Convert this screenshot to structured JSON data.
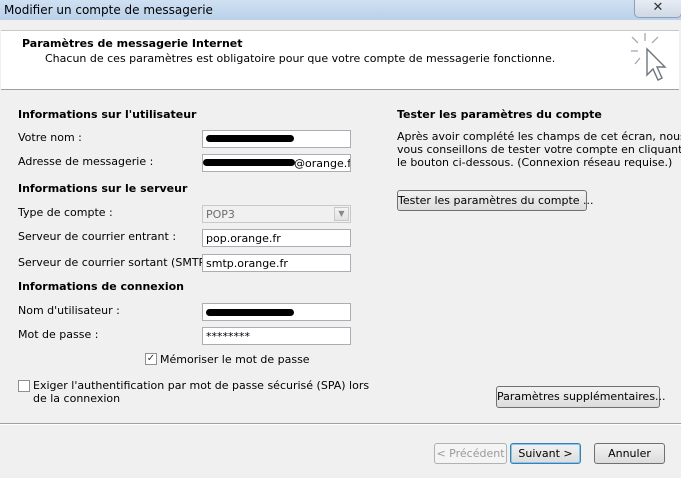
{
  "window": {
    "title": "Modifier un compte de messagerie",
    "close_glyph": "✕"
  },
  "header": {
    "title": "Paramètres de messagerie Internet",
    "description": "Chacun de ces paramètres est obligatoire pour que votre compte de messagerie fonctionne."
  },
  "user_info": {
    "heading": "Informations sur l'utilisateur",
    "name_label": "Votre nom :",
    "email_label": "Adresse de messagerie :",
    "email_suffix": "@orange.fr"
  },
  "server_info": {
    "heading": "Informations sur le serveur",
    "account_type_label": "Type de compte :",
    "account_type_value": "POP3",
    "incoming_label": "Serveur de courrier entrant :",
    "incoming_value": "pop.orange.fr",
    "outgoing_label": "Serveur de courrier sortant (SMTP) :",
    "outgoing_value": "smtp.orange.fr"
  },
  "login_info": {
    "heading": "Informations de connexion",
    "username_label": "Nom d'utilisateur :",
    "password_label": "Mot de passe :",
    "password_value": "********",
    "remember_label": "Mémoriser le mot de passe",
    "remember_checked": true,
    "spa_label_line1": "Exiger l'authentification par mot de passe sécurisé (SPA) lors",
    "spa_label_line2": "de la connexion",
    "spa_checked": false
  },
  "test": {
    "heading": "Tester les paramètres du compte",
    "desc_line1": "Après avoir complété les champs de cet écran, nous",
    "desc_line2": "vous conseillons de tester votre compte en cliquant sur",
    "desc_line3": "le bouton ci-dessous. (Connexion réseau requise.)",
    "test_button": "Tester les paramètres du compte ..."
  },
  "more_settings_button": "Paramètres supplémentaires...",
  "nav": {
    "back": "< Précédent",
    "next": "Suivant >",
    "cancel": "Annuler"
  },
  "icons": {
    "checkmark": "✓",
    "dropdown": "▼"
  }
}
